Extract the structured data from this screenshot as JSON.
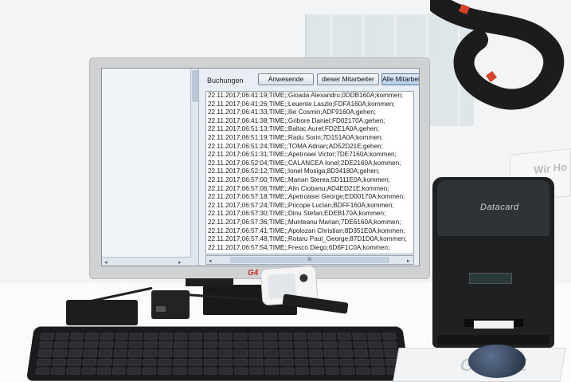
{
  "app": {
    "tabs_label": "Buchungen",
    "tabs": [
      {
        "label": "Anwesende",
        "active": false
      },
      {
        "label": "dieser Mitarbeiter",
        "active": false
      },
      {
        "label": "Alle Mitarbei",
        "active": true
      }
    ],
    "log": [
      "22.11.2017;06:41:19;TIME;;Gioada Alexandru;0DDB160A;kommen;",
      "22.11.2017;06:41:26;TIME;;Leuente Laszlo;FDFA160A;kommen;",
      "22.11.2017;06:41:33;TIME;;Ilie Cosmin;ADF9160A;gehen;",
      "22.11.2017;06:41:38;TIME;;Gribore Daniel;FD02170A;gehen;",
      "22.11.2017;06:51:13;TIME;;Baltac Aurel;FD2E1A0A;gehen;",
      "22.11.2017;06:51:19;TIME;;Radu Sorin;7D151A0A;kommen;",
      "22.11.2017;06:51:24;TIME;;TOMA Adrian;AD52D21E;gehen;",
      "22.11.2017;06:51:31;TIME;;Apetroaei Victor;7DE7160A;kommen;",
      "22.11.2017;06:52:04;TIME;;CALANCEA Ionel;2DE2160A;kommen;",
      "22.11.2017;06:52:12;TIME;;Ionel Mosiga;8D34180A;gehen;",
      "22.11.2017;06:57:00;TIME;;Marian Sterea;5D111E0A;kommen;",
      "22.11.2017;06:57:06;TIME;;Alin Ciobanu;AD4ED21E;kommen;",
      "22.11.2017;06:57:18;TIME;;Apetroasei George;ED00170A;kommen;",
      "22.11.2017;06:57:24;TIME;;Pricope Lucian;BDFF160A;kommen;",
      "22.11.2017;06:57:30;TIME;;Dinu Stefan;EDEB170A;kommen;",
      "22.11.2017;06:57:36;TIME;;Munteanu Marian;7DE6160A;kommen;",
      "22.11.2017;06:57:41;TIME;;Apolozan Christian;8D351E0A;kommen;",
      "22.11.2017;06:57:48;TIME;;Rotaru Paul_George;87D1D0A;kommen;",
      "22.11.2017;06:57:54;TIME;;Fresco Diego;6D6F1C0A;kommen;"
    ]
  },
  "monitor_logo": "G4",
  "printer_brand": "Datacard",
  "poster_text": "Wir Ho",
  "mousepad_text": "GASTE",
  "icons": {
    "scroll_up": "▲",
    "scroll_down": "▼",
    "scroll_left": "◂",
    "scroll_right": "▸",
    "scroll_grip": "III"
  }
}
